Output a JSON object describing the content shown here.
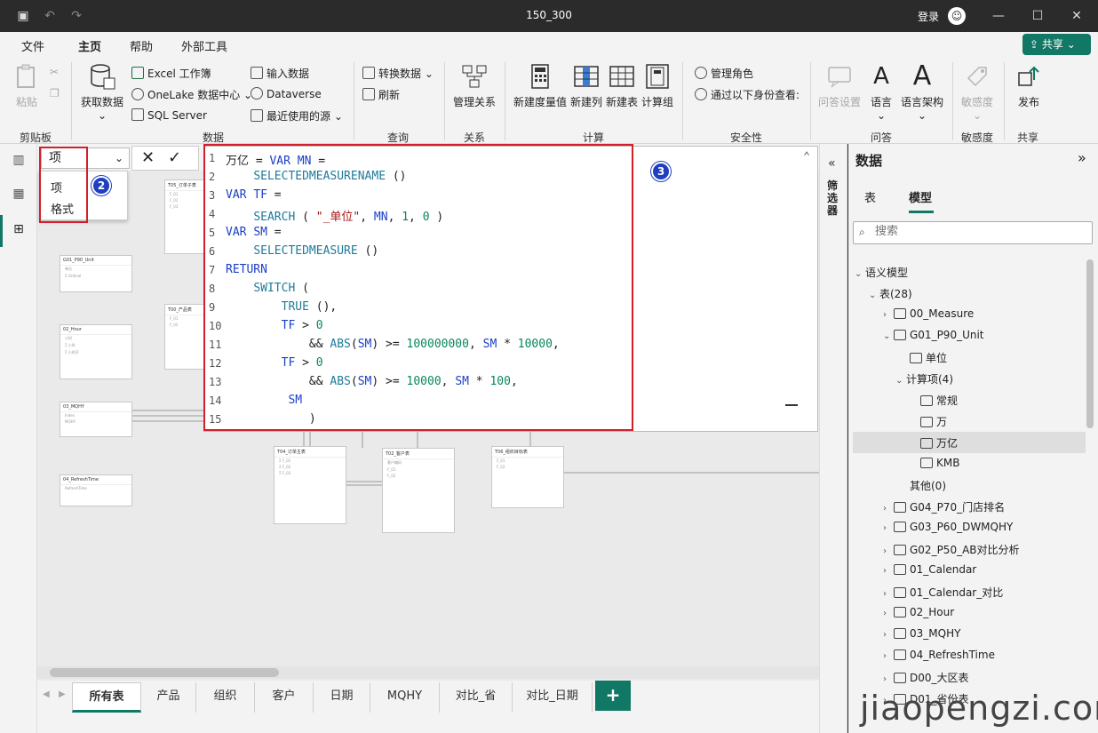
{
  "titlebar": {
    "title": "150_300",
    "login": "登录"
  },
  "menu": {
    "items": [
      "文件",
      "主页",
      "帮助",
      "外部工具"
    ],
    "share": "共享"
  },
  "ribbon": {
    "clipboard": {
      "paste": "粘贴",
      "group": "剪贴板"
    },
    "data": {
      "get_data": "获取数据",
      "excel": "Excel 工作簿",
      "onelake": "OneLake 数据中心",
      "sql": "SQL Server",
      "enter": "输入数据",
      "dataverse": "Dataverse",
      "recent": "最近使用的源",
      "group": "数据"
    },
    "query": {
      "transform": "转换数据",
      "refresh": "刷新",
      "group": "查询"
    },
    "relations": {
      "manage": "管理关系",
      "group": "关系"
    },
    "calc": {
      "new_measure": "新建度量值",
      "new_column": "新建列",
      "new_table": "新建表",
      "calc_group": "计算组",
      "group": "计算"
    },
    "security": {
      "roles": "管理角色",
      "view_as": "通过以下身份查看:",
      "group": "安全性"
    },
    "qa": {
      "setup": "问答设置",
      "lang": "语言",
      "schema": "语言架构",
      "group": "问答"
    },
    "sensitivity": {
      "label": "敏感度",
      "group": "敏感度"
    },
    "share": {
      "publish": "发布",
      "group": "共享"
    }
  },
  "formula": {
    "selector": "项",
    "dropdown": [
      "项",
      "格式"
    ],
    "lines": [
      {
        "n": "1",
        "t": "万亿 = VAR MN ="
      },
      {
        "n": "2",
        "t": "    SELECTEDMEASURENAME ()"
      },
      {
        "n": "3",
        "t": "VAR TF ="
      },
      {
        "n": "4",
        "t": "    SEARCH ( \"_单位\", MN, 1, 0 )"
      },
      {
        "n": "5",
        "t": "VAR SM ="
      },
      {
        "n": "6",
        "t": "    SELECTEDMEASURE ()"
      },
      {
        "n": "7",
        "t": "RETURN"
      },
      {
        "n": "8",
        "t": "    SWITCH ("
      },
      {
        "n": "9",
        "t": "        TRUE (),"
      },
      {
        "n": "10",
        "t": "        TF > 0"
      },
      {
        "n": "11",
        "t": "            && ABS(SM) >= 100000000, SM * 10000,"
      },
      {
        "n": "12",
        "t": "        TF > 0"
      },
      {
        "n": "13",
        "t": "            && ABS(SM) >= 10000, SM * 100,"
      },
      {
        "n": "14",
        "t": "         SM"
      },
      {
        "n": "15",
        "t": "            )"
      }
    ]
  },
  "badges": [
    "1",
    "2",
    "3"
  ],
  "tabs": [
    "所有表",
    "产品",
    "组织",
    "客户",
    "日期",
    "MQHY",
    "对比_省",
    "对比_日期"
  ],
  "filter_label": "筛选器",
  "datapane": {
    "title": "数据",
    "tabs": [
      "表",
      "模型"
    ],
    "search_placeholder": "搜索",
    "tree": [
      {
        "label": "语义模型"
      },
      {
        "label": "表(28)"
      },
      {
        "label": "00_Measure"
      },
      {
        "label": "G01_P90_Unit"
      },
      {
        "label": "单位"
      },
      {
        "label": "计算项(4)"
      },
      {
        "label": "常规"
      },
      {
        "label": "万"
      },
      {
        "label": "万亿"
      },
      {
        "label": "KMB"
      },
      {
        "label": "其他(0)"
      },
      {
        "label": "G04_P70_门店排名"
      },
      {
        "label": "G03_P60_DWMQHY"
      },
      {
        "label": "G02_P50_AB对比分析"
      },
      {
        "label": "01_Calendar"
      },
      {
        "label": "01_Calendar_对比"
      },
      {
        "label": "02_Hour"
      },
      {
        "label": "03_MQHY"
      },
      {
        "label": "04_RefreshTime"
      },
      {
        "label": "D00_大区表"
      },
      {
        "label": "D01_省份表"
      }
    ]
  },
  "canvas_cards": [
    "G01_P90_Unit",
    "02_Hour",
    "03_MQHY",
    "04_RefreshTime",
    "T05_订单子表",
    "T00_产品表",
    "T04_订单主表",
    "T02_客户表",
    "T06_组织目标表"
  ],
  "watermark": "jiaopengzi.com"
}
